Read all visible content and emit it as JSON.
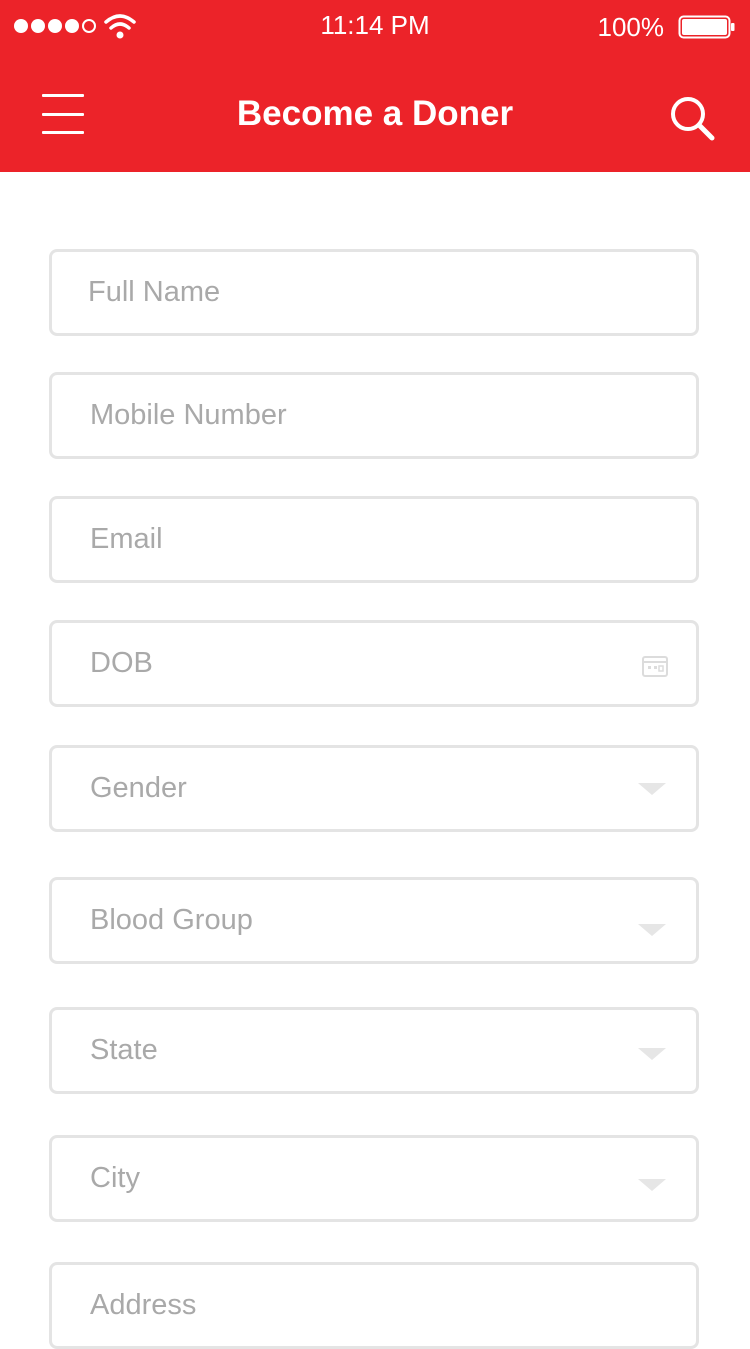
{
  "status_bar": {
    "time": "11:14 PM",
    "battery_percent": "100%",
    "signal_dots_filled": 4,
    "signal_dots_total": 5
  },
  "header": {
    "title": "Become a Doner",
    "background_color": "#ec2329",
    "menu_icon": "hamburger-menu-icon",
    "search_icon": "search-icon"
  },
  "form": {
    "fields": [
      {
        "placeholder": "Full Name",
        "type": "text"
      },
      {
        "placeholder": "Mobile Number",
        "type": "text"
      },
      {
        "placeholder": "Email",
        "type": "text"
      },
      {
        "placeholder": "DOB",
        "type": "date",
        "icon": "calendar-icon"
      },
      {
        "placeholder": "Gender",
        "type": "select",
        "icon": "chevron-down-icon"
      },
      {
        "placeholder": "Blood Group",
        "type": "select",
        "icon": "chevron-down-icon"
      },
      {
        "placeholder": "State",
        "type": "select",
        "icon": "chevron-down-icon"
      },
      {
        "placeholder": "City",
        "type": "select",
        "icon": "chevron-down-icon"
      },
      {
        "placeholder": "Address",
        "type": "text"
      }
    ]
  }
}
